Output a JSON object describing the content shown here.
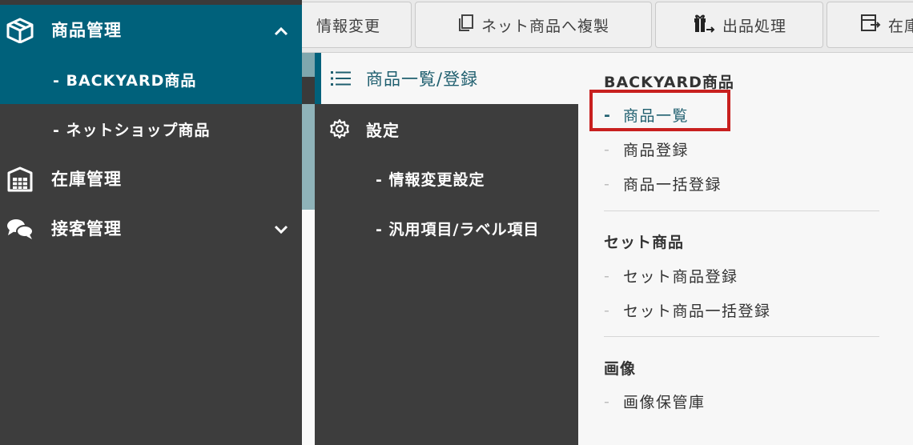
{
  "toolbar": {
    "buttons": [
      {
        "label": "情報変更",
        "icon": "none"
      },
      {
        "label": "ネット商品へ複製",
        "icon": "copy-icon"
      },
      {
        "label": "出品処理",
        "icon": "gift-export-icon"
      },
      {
        "label": "在庫",
        "icon": "inventory-export-icon"
      }
    ]
  },
  "left_menu": {
    "items": [
      {
        "label": "商品管理",
        "icon": "box-icon",
        "expanded": true
      },
      {
        "label": "- BACKYARD商品",
        "selected": true
      },
      {
        "label": "- ネットショップ商品"
      },
      {
        "label": "在庫管理",
        "icon": "warehouse-icon"
      },
      {
        "label": "接客管理",
        "icon": "chat-bubbles-icon",
        "expanded": false
      }
    ]
  },
  "mid_menu": {
    "items": [
      {
        "label": "商品一覧/登録",
        "icon": "list-icon",
        "selected": true
      },
      {
        "label": "設定",
        "icon": "gear-icon"
      },
      {
        "label": "- 情報変更設定"
      },
      {
        "label": "- 汎用項目/ラベル項目"
      }
    ]
  },
  "right_panel": {
    "sections": [
      {
        "heading": "BACKYARD商品",
        "links": [
          "商品一覧",
          "商品登録",
          "商品一括登録"
        ]
      },
      {
        "heading": "セット商品",
        "links": [
          "セット商品登録",
          "セット商品一括登録"
        ]
      },
      {
        "heading": "画像",
        "links": [
          "画像保管庫"
        ]
      }
    ],
    "dash": "-"
  },
  "colors": {
    "sidebar_bg": "#3d3d3d",
    "active_teal": "#00617b",
    "panel_bg": "#f7f7f7",
    "highlight_red": "#c8201f"
  }
}
